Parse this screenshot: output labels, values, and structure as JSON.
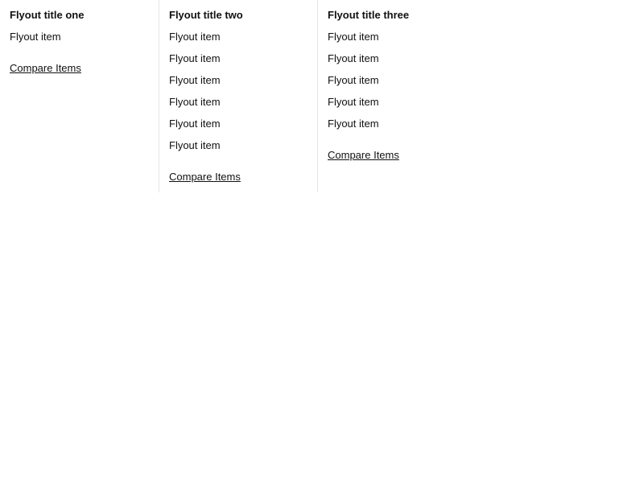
{
  "flyout": {
    "columns": [
      {
        "title": "Flyout title one",
        "items": [
          "Flyout item"
        ],
        "compare_label": "Compare Items"
      },
      {
        "title": "Flyout title two",
        "items": [
          "Flyout item",
          "Flyout item",
          "Flyout item",
          "Flyout item",
          "Flyout item",
          "Flyout item"
        ],
        "compare_label": "Compare Items"
      },
      {
        "title": "Flyout title three",
        "items": [
          "Flyout item",
          "Flyout item",
          "Flyout item",
          "Flyout item",
          "Flyout item"
        ],
        "compare_label": "Compare Items"
      }
    ]
  }
}
